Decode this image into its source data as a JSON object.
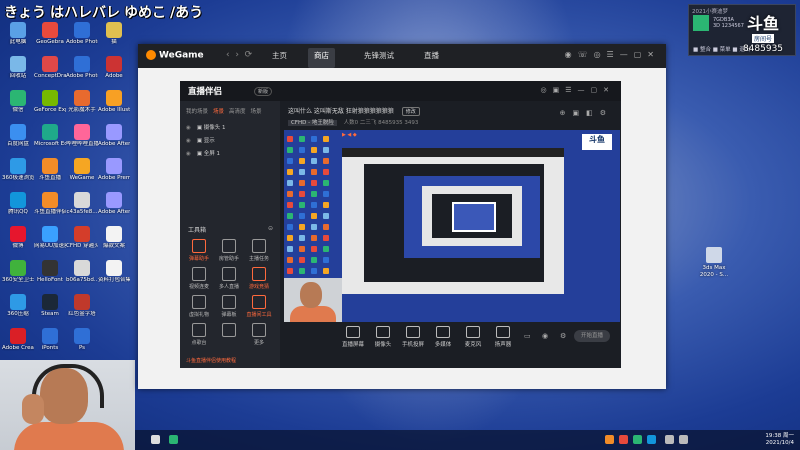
{
  "stream_title": [
    "きょう",
    "はハレバレ",
    "ゆめこ",
    "/あう"
  ],
  "desktop_icons": [
    {
      "label": "此电脑",
      "color": "#5aa0e6"
    },
    {
      "label": "GeoGebra",
      "color": "#e84a3c"
    },
    {
      "label": "Adobe Photosh...",
      "color": "#2f6fd6"
    },
    {
      "label": "猫",
      "color": "#e0c050"
    },
    {
      "label": "回收站",
      "color": "#7ab8e8"
    },
    {
      "label": "ConceptDraw 光影精灵",
      "color": "#e04848"
    },
    {
      "label": "Adobe Photosh...",
      "color": "#2f6fd6"
    },
    {
      "label": "Adobe",
      "color": "#cc3333"
    },
    {
      "label": "微信",
      "color": "#2bb673"
    },
    {
      "label": "GeForce Experience",
      "color": "#76b900"
    },
    {
      "label": "光影魔术手",
      "color": "#e86a2e"
    },
    {
      "label": "Adobe Illustr...",
      "color": "#f7a024"
    },
    {
      "label": "百度网盘",
      "color": "#3b8ff0"
    },
    {
      "label": "Microsoft Edge",
      "color": "#1faa8a"
    },
    {
      "label": "哔哩哔哩直播",
      "color": "#ff6699"
    },
    {
      "label": "Adobe After...",
      "color": "#9999ff"
    },
    {
      "label": "360极速浏览器",
      "color": "#2e9ae6"
    },
    {
      "label": "斗鱼直播",
      "color": "#f28c28"
    },
    {
      "label": "WeGame",
      "color": "#f5a623"
    },
    {
      "label": "Adobe Premiere",
      "color": "#9999ff"
    },
    {
      "label": "腾讯QQ",
      "color": "#1296db"
    },
    {
      "label": "斗鱼直播伴侣",
      "color": "#f28c28"
    },
    {
      "label": "c43a5fe8...",
      "color": "#d9d9d9"
    },
    {
      "label": "Adobe After Effects 2020",
      "color": "#9999ff"
    },
    {
      "label": "微博",
      "color": "#e6162d"
    },
    {
      "label": "网易UU加速器",
      "color": "#3aa0ff"
    },
    {
      "label": "CFHD 穿越火线",
      "color": "#d43d2a"
    },
    {
      "label": "爆款文案",
      "color": "#f3f3f3"
    },
    {
      "label": "360安全卫士",
      "color": "#40b23c"
    },
    {
      "label": "HelloFont",
      "color": "#333333"
    },
    {
      "label": "b06a75bd...",
      "color": "#d9d9d9"
    },
    {
      "label": "资料打包合集",
      "color": "#f3f3f3"
    },
    {
      "label": "360压缩",
      "color": "#2e9ae6"
    },
    {
      "label": "Steam",
      "color": "#1b2838"
    },
    {
      "label": "红色金字塔",
      "color": "#c0392b"
    },
    {
      "label": "",
      "color": "rgba(0,0,0,0)"
    },
    {
      "label": "Adobe Creati...",
      "color": "#da1f26"
    },
    {
      "label": "iPonts",
      "color": "#2f6fd6"
    },
    {
      "label": "Ps",
      "color": "#2f6fd6"
    },
    {
      "label": "",
      "color": "rgba(0,0,0,0)"
    }
  ],
  "right_icon": {
    "label": "3ds Max 2020 - S..."
  },
  "notification": {
    "header": "2021小赛迪梦",
    "line1": "7GDB3A",
    "line2": "3D 1234567",
    "row": "■ 整合   ■ 菜单   ■ 退出"
  },
  "brand_badge": {
    "big": "斗鱼",
    "sub": "房间号",
    "id": "8485935"
  },
  "taskbar": {
    "time": "19:38 周一",
    "date": "2021/10/4"
  },
  "wegame": {
    "logo": "WeGame",
    "nav": [
      {
        "label": "主页",
        "active": false
      },
      {
        "label": "商店",
        "active": true
      },
      {
        "label": "先锋测试",
        "active": false
      },
      {
        "label": "直播",
        "active": false
      }
    ]
  },
  "zbp": {
    "logo": "直播伴侣",
    "version": "新版",
    "side_tabs": [
      "我的场景",
      "场景",
      "高清度",
      "场景"
    ],
    "scenes": [
      "▣ 摄像头 1",
      "▣ 显示",
      "▣ 全屏 1"
    ],
    "tools_title": "工具箱",
    "tools": [
      {
        "label": "弹幕助手",
        "hot": true
      },
      {
        "label": "房管助手",
        "hot": false
      },
      {
        "label": "主播任务",
        "hot": false
      },
      {
        "label": "视频连麦",
        "hot": false
      },
      {
        "label": "多人直播",
        "hot": false
      },
      {
        "label": "游戏竞猜",
        "hot": true
      },
      {
        "label": "虚拟礼物",
        "hot": false
      },
      {
        "label": "弹幕板",
        "hot": false
      },
      {
        "label": "直播间工具",
        "hot": true
      },
      {
        "label": "点歌台",
        "hot": false
      },
      {
        "label": "",
        "hot": false
      },
      {
        "label": "更多",
        "hot": false
      }
    ],
    "footer": "斗鱼直播伴侣使用教程",
    "header_title": "这叫什么 这叫斯无敌 狂射狼狼狼狼狼狼",
    "header_btn": "修改",
    "meta_tag": "CFHD - 地王脱险",
    "meta_id": "人数0 二三飞",
    "meta_room": "8485935",
    "meta_num": "3493",
    "bottom": [
      "直播屏幕",
      "摄像头",
      "手机投屏",
      "多媒体",
      "麦克风",
      "扬声器"
    ],
    "start": "开始直播"
  }
}
